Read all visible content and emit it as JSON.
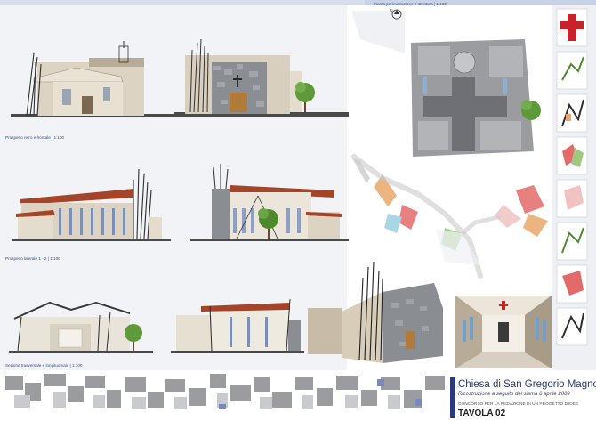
{
  "board": {
    "top_label": "Pianta perimetrazione e struttura | 1:100",
    "north_label": "N"
  },
  "labels": {
    "front_rear": "Prospetto retro e frontale | 1:100",
    "lateral": "Prospetto laterale 1 - 2 | 1:100",
    "sections": "Sezione trasversale e longitudinale | 1:100"
  },
  "title_block": {
    "title": "Chiesa di San Gregorio Magno",
    "subtitle": "Ricostruzione a seguito del sisma 6 aprile 2009",
    "contest": "CONCORSO PER LA REDAZIONE DI UN PROGETTO D'IDEE",
    "sheet": "TAVOLA 02"
  },
  "colors": {
    "blue_text": "#2a4fa0",
    "roof_red": "#a4452a",
    "wall_beige": "#dcd3c2",
    "stone_grey": "#8a8d92",
    "cross_red": "#c8232a",
    "tree_green": "#5f9a3a"
  },
  "icons": [
    "north-arrow-icon",
    "cross-icon",
    "tree-icon",
    "window-strip-icon",
    "glass-panel-icon"
  ]
}
